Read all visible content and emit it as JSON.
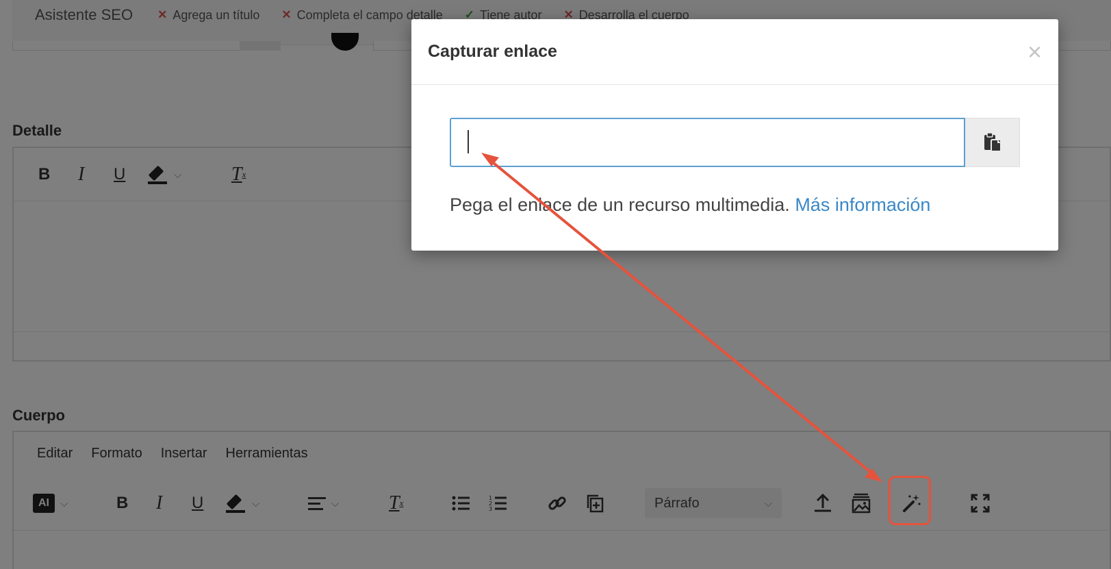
{
  "seo": {
    "title": "Asistente SEO",
    "checks": [
      {
        "label": "Agrega un título",
        "status": "fail"
      },
      {
        "label": "Completa el campo detalle",
        "status": "fail"
      },
      {
        "label": "Tiene autor",
        "status": "ok"
      },
      {
        "label": "Desarrolla el cuerpo",
        "status": "fail"
      }
    ]
  },
  "detalle": {
    "label": "Detalle"
  },
  "cuerpo": {
    "label": "Cuerpo",
    "menu": [
      "Editar",
      "Formato",
      "Insertar",
      "Herramientas"
    ],
    "ai_badge": "AI",
    "format_select": "Párrafo"
  },
  "toolbar": {
    "bold": "B",
    "italic": "I",
    "underline": "U",
    "clear_format": "T",
    "clear_sub": "x"
  },
  "modal": {
    "title": "Capturar enlace",
    "close": "×",
    "input_value": "",
    "help_text": "Pega el enlace de un recurso multimedia.",
    "help_link": "Más información"
  },
  "colors": {
    "accent_link": "#3a87c7",
    "input_focus": "#5a9fd4",
    "annotation": "#e5533c",
    "fail": "#d9534f",
    "ok": "#3c9a3c"
  }
}
